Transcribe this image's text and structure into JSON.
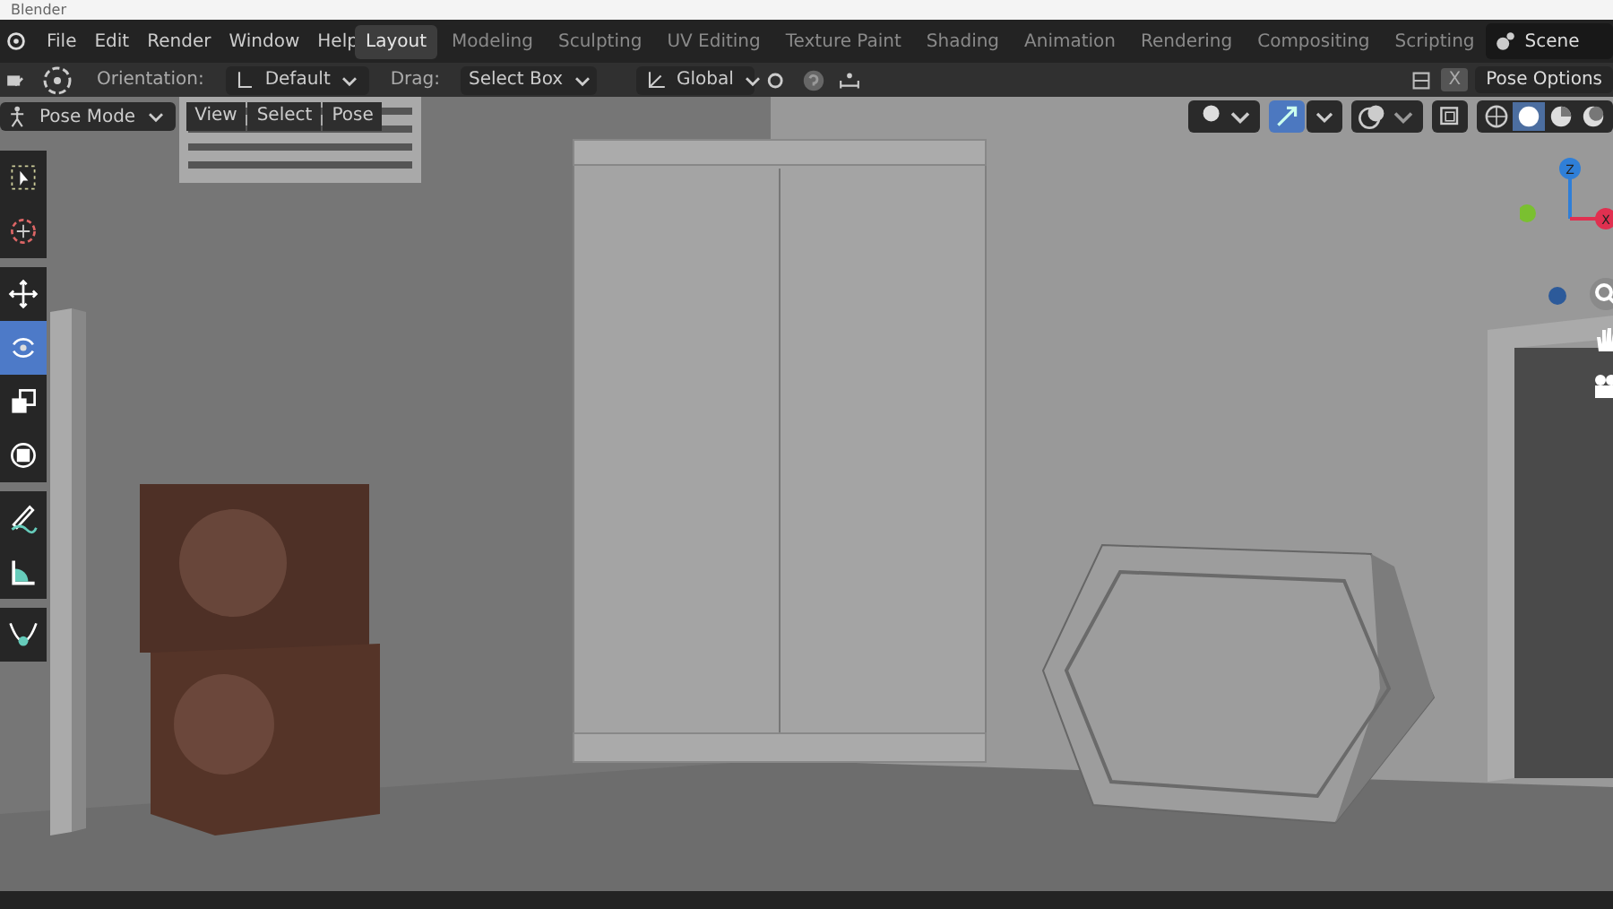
{
  "title_bar": {
    "title": "Blender"
  },
  "menu": [
    "File",
    "Edit",
    "Render",
    "Window",
    "Help"
  ],
  "workspaces": [
    {
      "label": "Layout",
      "selected": true
    },
    {
      "label": "Modeling",
      "selected": false
    },
    {
      "label": "Sculpting",
      "selected": false
    },
    {
      "label": "UV Editing",
      "selected": false
    },
    {
      "label": "Texture Paint",
      "selected": false
    },
    {
      "label": "Shading",
      "selected": false
    },
    {
      "label": "Animation",
      "selected": false
    },
    {
      "label": "Rendering",
      "selected": false
    },
    {
      "label": "Compositing",
      "selected": false
    },
    {
      "label": "Scripting",
      "selected": false
    }
  ],
  "scene": {
    "label": "Scene"
  },
  "tool_header": {
    "orientation_label": "Orientation:",
    "orientation": "Default",
    "drag_label": "Drag:",
    "drag": "Select Box",
    "transform_orientation": "Global",
    "x_toggle": "X",
    "pose_options": "Pose Options"
  },
  "viewport_header": {
    "mode": "Pose Mode",
    "menus": [
      "View",
      "Select",
      "Pose"
    ],
    "gizmo_toggle": {
      "selected": true
    }
  },
  "toolbar": [
    {
      "kind": "select",
      "selected": false
    },
    {
      "kind": "cursor",
      "selected": false
    },
    {
      "kind": "move",
      "selected": false
    },
    {
      "kind": "rotate",
      "selected": true
    },
    {
      "kind": "scale",
      "selected": false
    },
    {
      "kind": "transform",
      "selected": false
    },
    {
      "kind": "annotate",
      "selected": false
    },
    {
      "kind": "measure",
      "selected": false
    },
    {
      "kind": "bend",
      "selected": false
    }
  ],
  "shading": [
    {
      "kind": "wireframe",
      "selected": false
    },
    {
      "kind": "solid",
      "selected": true
    },
    {
      "kind": "material",
      "selected": false
    },
    {
      "kind": "rendered",
      "selected": false
    }
  ],
  "gizmo": {
    "z_label": "Z",
    "x_label": "X"
  }
}
